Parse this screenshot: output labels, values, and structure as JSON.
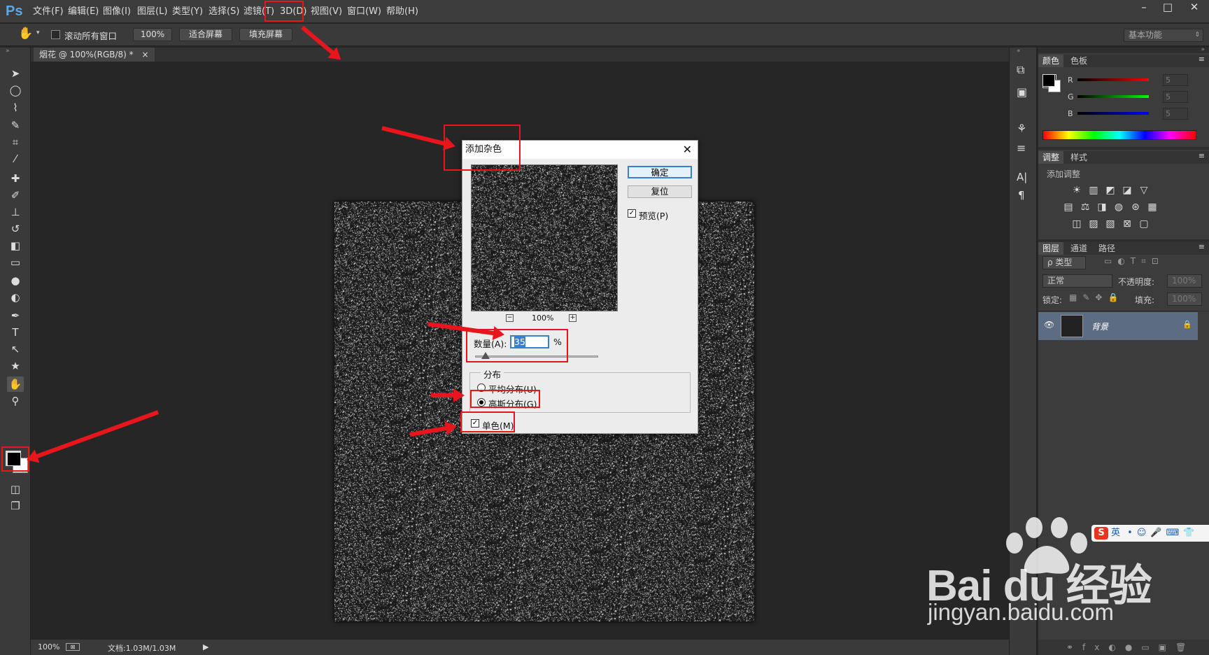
{
  "app": {
    "logo": "Ps"
  },
  "menu": [
    "文件(F)",
    "编辑(E)",
    "图像(I)",
    "图层(L)",
    "类型(Y)",
    "选择(S)",
    "滤镜(T)",
    "3D(D)",
    "视图(V)",
    "窗口(W)",
    "帮助(H)"
  ],
  "window_controls": [
    "–",
    "□",
    "✕"
  ],
  "options_bar": {
    "scroll_all": "滚动所有窗口",
    "zoom_100": "100%",
    "fit_screen": "适合屏幕",
    "fill_screen": "填充屏幕",
    "workspace": "基本功能"
  },
  "document": {
    "tab": "烟花 @ 100%(RGB/8) *",
    "close": "×"
  },
  "status": {
    "zoom": "100%",
    "doc_info": "文档:1.03M/1.03M"
  },
  "color_panel": {
    "tabs": [
      "颜色",
      "色板"
    ],
    "channels": [
      {
        "label": "R",
        "value": "5"
      },
      {
        "label": "G",
        "value": "5"
      },
      {
        "label": "B",
        "value": "5"
      }
    ],
    "colors": {
      "r": "#ff0000",
      "g": "#00ff00",
      "b": "#0000ff"
    }
  },
  "adjust_panel": {
    "tabs": [
      "调整",
      "样式"
    ],
    "heading": "添加调整"
  },
  "layers_panel": {
    "tabs": [
      "图层",
      "通道",
      "路径"
    ],
    "filter": "ρ 类型",
    "blend": "正常",
    "opacity_label": "不透明度:",
    "opacity": "100%",
    "lock_label": "锁定:",
    "fill_label": "填充:",
    "fill": "100%",
    "layer_name": "背景"
  },
  "dialog": {
    "title": "添加杂色",
    "ok": "确定",
    "reset": "复位",
    "preview": "预览(P)",
    "zoom": "100%",
    "amount_label": "数量(A):",
    "amount": "35",
    "percent": "%",
    "distribution_label": "分布",
    "uniform": "平均分布(U)",
    "gaussian": "高斯分布(G)",
    "mono": "单色(M)"
  },
  "watermark": {
    "brand": "Bai du 经验",
    "url": "jingyan.baidu.com"
  },
  "ime_bar": {
    "label": "英"
  }
}
